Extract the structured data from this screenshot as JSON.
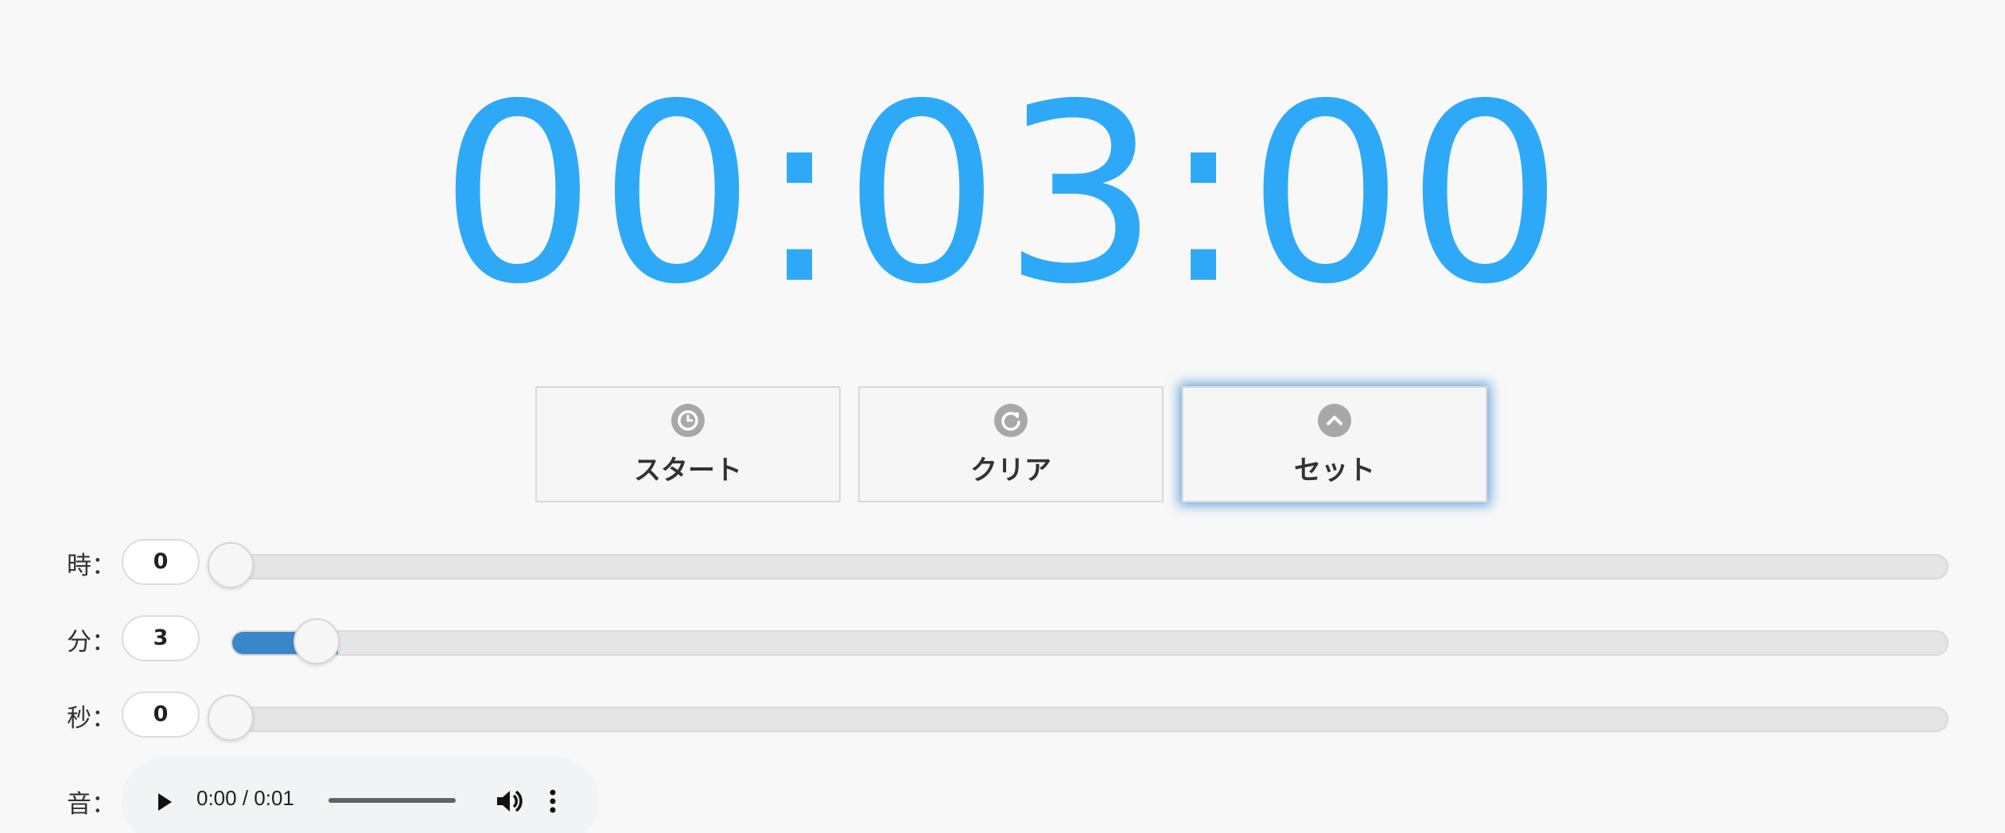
{
  "timer": {
    "display": "00:03:00",
    "color": "#2ea9f8"
  },
  "buttons": [
    {
      "label": "スタート",
      "icon": "clock-icon"
    },
    {
      "label": "クリア",
      "icon": "refresh-icon"
    },
    {
      "label": "セット",
      "icon": "chevron-up-icon"
    }
  ],
  "sliders": {
    "hours": {
      "label": "時：",
      "value": "0",
      "level": 0.0
    },
    "minutes": {
      "label": "分：",
      "value": "3",
      "level": 0.05
    },
    "seconds": {
      "label": "秒：",
      "value": "0",
      "level": 0.0
    }
  },
  "audio": {
    "label": "音：",
    "time": "0:00 / 0:01",
    "icons": [
      "play-icon",
      "volume-icon",
      "more-vert-icon"
    ]
  },
  "colors": {
    "accent": "#3b86c9",
    "timer": "#2ea9f8",
    "background": "#f8f8f8"
  }
}
